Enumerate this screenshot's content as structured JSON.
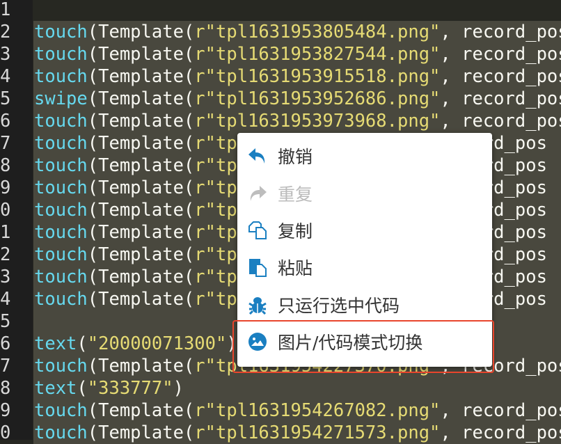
{
  "editor": {
    "lines": [
      {
        "num": "1",
        "parts": []
      },
      {
        "num": "2",
        "parts": [
          [
            "fn",
            "touch"
          ],
          [
            "pl",
            "(Template("
          ],
          [
            "str",
            "r\"tpl1631953805484.png\""
          ],
          [
            "pl",
            ", record_pos"
          ]
        ]
      },
      {
        "num": "3",
        "parts": [
          [
            "fn",
            "touch"
          ],
          [
            "pl",
            "(Template("
          ],
          [
            "str",
            "r\"tpl1631953827544.png\""
          ],
          [
            "pl",
            ", record_pos"
          ]
        ]
      },
      {
        "num": "4",
        "parts": [
          [
            "fn",
            "touch"
          ],
          [
            "pl",
            "(Template("
          ],
          [
            "str",
            "r\"tpl1631953915518.png\""
          ],
          [
            "pl",
            ", record_pos"
          ]
        ]
      },
      {
        "num": "5",
        "parts": [
          [
            "fn",
            "swipe"
          ],
          [
            "pl",
            "(Template("
          ],
          [
            "str",
            "r\"tpl1631953952686.png\""
          ],
          [
            "pl",
            ", record_pos"
          ]
        ]
      },
      {
        "num": "6",
        "parts": [
          [
            "fn",
            "touch"
          ],
          [
            "pl",
            "(Template("
          ],
          [
            "str",
            "r\"tpl1631953973968.png\""
          ],
          [
            "pl",
            ", record_pos"
          ]
        ]
      },
      {
        "num": "7",
        "parts": [
          [
            "fn",
            "touch"
          ],
          [
            "pl",
            "(Template("
          ],
          [
            "str",
            "r\"tpl"
          ],
          [
            "pl",
            "                     ord_pos"
          ]
        ]
      },
      {
        "num": "8",
        "parts": [
          [
            "fn",
            "touch"
          ],
          [
            "pl",
            "(Template("
          ],
          [
            "str",
            "r\"tpl"
          ],
          [
            "pl",
            "                     ord_pos"
          ]
        ]
      },
      {
        "num": "9",
        "parts": [
          [
            "fn",
            "touch"
          ],
          [
            "pl",
            "(Template("
          ],
          [
            "str",
            "r\"tpl"
          ],
          [
            "pl",
            "                     ord_pos"
          ]
        ]
      },
      {
        "num": "0",
        "parts": [
          [
            "fn",
            "touch"
          ],
          [
            "pl",
            "(Template("
          ],
          [
            "str",
            "r\"tpl"
          ],
          [
            "pl",
            "                     ord_pos"
          ]
        ]
      },
      {
        "num": "1",
        "parts": [
          [
            "fn",
            "touch"
          ],
          [
            "pl",
            "(Template("
          ],
          [
            "str",
            "r\"tpl"
          ],
          [
            "pl",
            "                     ord_pos"
          ]
        ]
      },
      {
        "num": "2",
        "parts": [
          [
            "fn",
            "touch"
          ],
          [
            "pl",
            "(Template("
          ],
          [
            "str",
            "r\"tpl"
          ],
          [
            "pl",
            "                     ord_pos"
          ]
        ]
      },
      {
        "num": "3",
        "parts": [
          [
            "fn",
            "touch"
          ],
          [
            "pl",
            "(Template("
          ],
          [
            "str",
            "r\"tpl"
          ],
          [
            "pl",
            "                     ord_pos"
          ]
        ]
      },
      {
        "num": "4",
        "parts": [
          [
            "fn",
            "touch"
          ],
          [
            "pl",
            "(Template("
          ],
          [
            "str",
            "r\"tpl"
          ],
          [
            "pl",
            "                     ord_pos"
          ]
        ]
      },
      {
        "num": "5",
        "parts": []
      },
      {
        "num": "6",
        "parts": [
          [
            "fn",
            "text"
          ],
          [
            "pl",
            "("
          ],
          [
            "str",
            "\"20000071300\""
          ],
          [
            "pl",
            ")"
          ]
        ]
      },
      {
        "num": "7",
        "parts": [
          [
            "fn",
            "touch"
          ],
          [
            "pl",
            "(Template("
          ],
          [
            "str",
            "r\"tpl1631954227370.png\""
          ],
          [
            "pl",
            ", record_pos"
          ]
        ]
      },
      {
        "num": "8",
        "parts": [
          [
            "fn",
            "text"
          ],
          [
            "pl",
            "("
          ],
          [
            "str",
            "\"333777\""
          ],
          [
            "pl",
            ")"
          ]
        ]
      },
      {
        "num": "9",
        "parts": [
          [
            "fn",
            "touch"
          ],
          [
            "pl",
            "(Template("
          ],
          [
            "str",
            "r\"tpl1631954267082.png\""
          ],
          [
            "pl",
            ", record_pos"
          ]
        ]
      },
      {
        "num": "0",
        "parts": [
          [
            "fn",
            "touch"
          ],
          [
            "pl",
            "(Template("
          ],
          [
            "str",
            "r\"tpl1631954271573.png\""
          ],
          [
            "pl",
            ", record_pos"
          ]
        ]
      }
    ]
  },
  "context_menu": {
    "items": [
      {
        "label": "撤销",
        "icon": "undo-icon",
        "enabled": true
      },
      {
        "label": "重复",
        "icon": "redo-icon",
        "enabled": false
      },
      {
        "label": "复制",
        "icon": "copy-icon",
        "enabled": true
      },
      {
        "label": "粘贴",
        "icon": "paste-icon",
        "enabled": true
      },
      {
        "label": "只运行选中代码",
        "icon": "bug-icon",
        "enabled": true
      },
      {
        "label": "图片/代码模式切换",
        "icon": "image-icon",
        "enabled": true
      }
    ],
    "highlighted_item": "图片/代码模式切换"
  },
  "colors": {
    "function": "#66d9ef",
    "string": "#e6db74",
    "plain": "#f8f8f2",
    "selection": "#49483e",
    "icon": "#1a7fc1",
    "highlight_border": "#e8452c"
  }
}
